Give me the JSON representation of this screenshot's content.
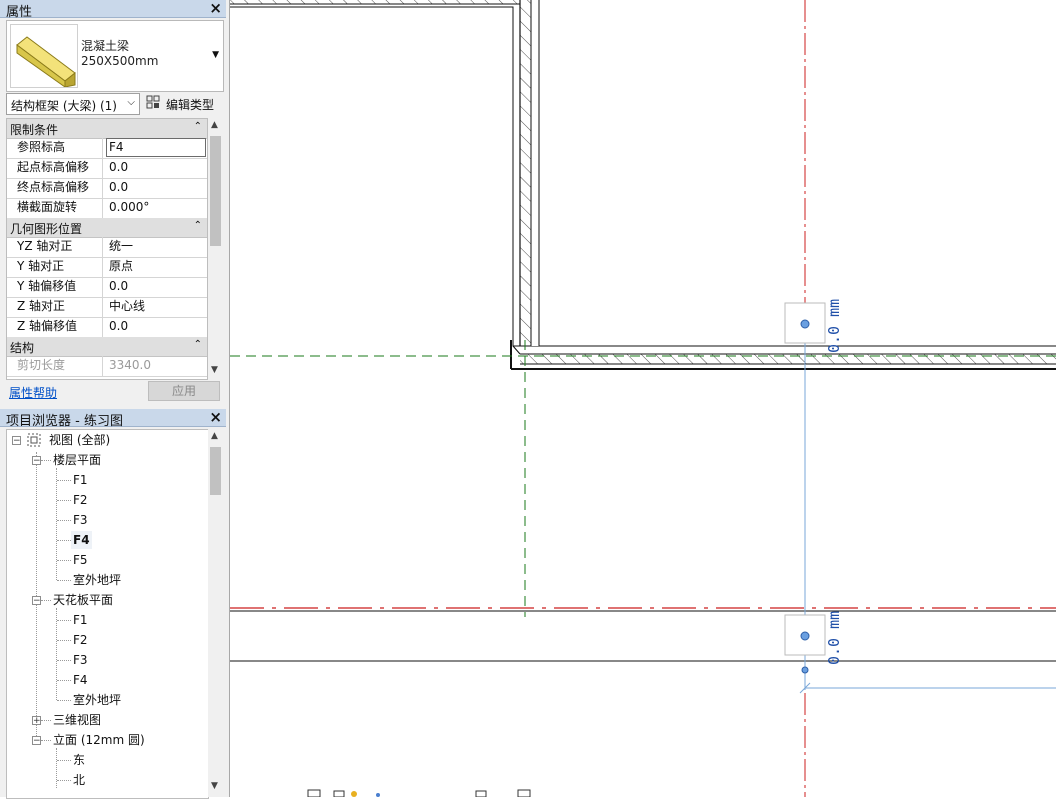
{
  "properties": {
    "title": "属性",
    "type_family": "混凝土梁",
    "type_size": "250X500mm",
    "filter_label": "结构框架 (大梁) (1)",
    "edit_type_label": "编辑类型",
    "groups": [
      {
        "name": "限制条件",
        "rows": [
          {
            "key": "参照标高",
            "value": "F4"
          },
          {
            "key": "起点标高偏移",
            "value": "0.0"
          },
          {
            "key": "终点标高偏移",
            "value": "0.0"
          },
          {
            "key": "横截面旋转",
            "value": "0.000°"
          }
        ]
      },
      {
        "name": "几何图形位置",
        "rows": [
          {
            "key": "YZ 轴对正",
            "value": "统一"
          },
          {
            "key": "Y 轴对正",
            "value": "原点"
          },
          {
            "key": "Y 轴偏移值",
            "value": "0.0"
          },
          {
            "key": "Z 轴对正",
            "value": "中心线"
          },
          {
            "key": "Z 轴偏移值",
            "value": "0.0"
          }
        ]
      },
      {
        "name": "结构",
        "rows": [
          {
            "key": "剪切长度",
            "value": "3340.0"
          }
        ]
      }
    ],
    "help_link": "属性帮助",
    "apply_label": "应用"
  },
  "browser": {
    "title": "项目浏览器 - 练习图",
    "root_label": "视图 (全部)",
    "floor_plans_label": "楼层平面",
    "floor_plans": [
      "F1",
      "F2",
      "F3",
      "F4",
      "F5",
      "室外地坪"
    ],
    "active_floor_plan": "F4",
    "ceiling_plans_label": "天花板平面",
    "ceiling_plans": [
      "F1",
      "F2",
      "F3",
      "F4",
      "室外地坪"
    ],
    "three_d_label": "三维视图",
    "elevations_label": "立面 (12mm 圆)",
    "elevations": [
      "东",
      "北"
    ]
  },
  "canvas": {
    "dim_top": "0.0 mm",
    "dim_bottom": "0.0 mm"
  },
  "colors": {
    "title_bar": "#c9d8ea",
    "grid_red": "#cc1f1f",
    "grid_green": "#1a7a1a",
    "dimension_blue": "#1f4fa8",
    "link_blue": "#0050c8"
  }
}
